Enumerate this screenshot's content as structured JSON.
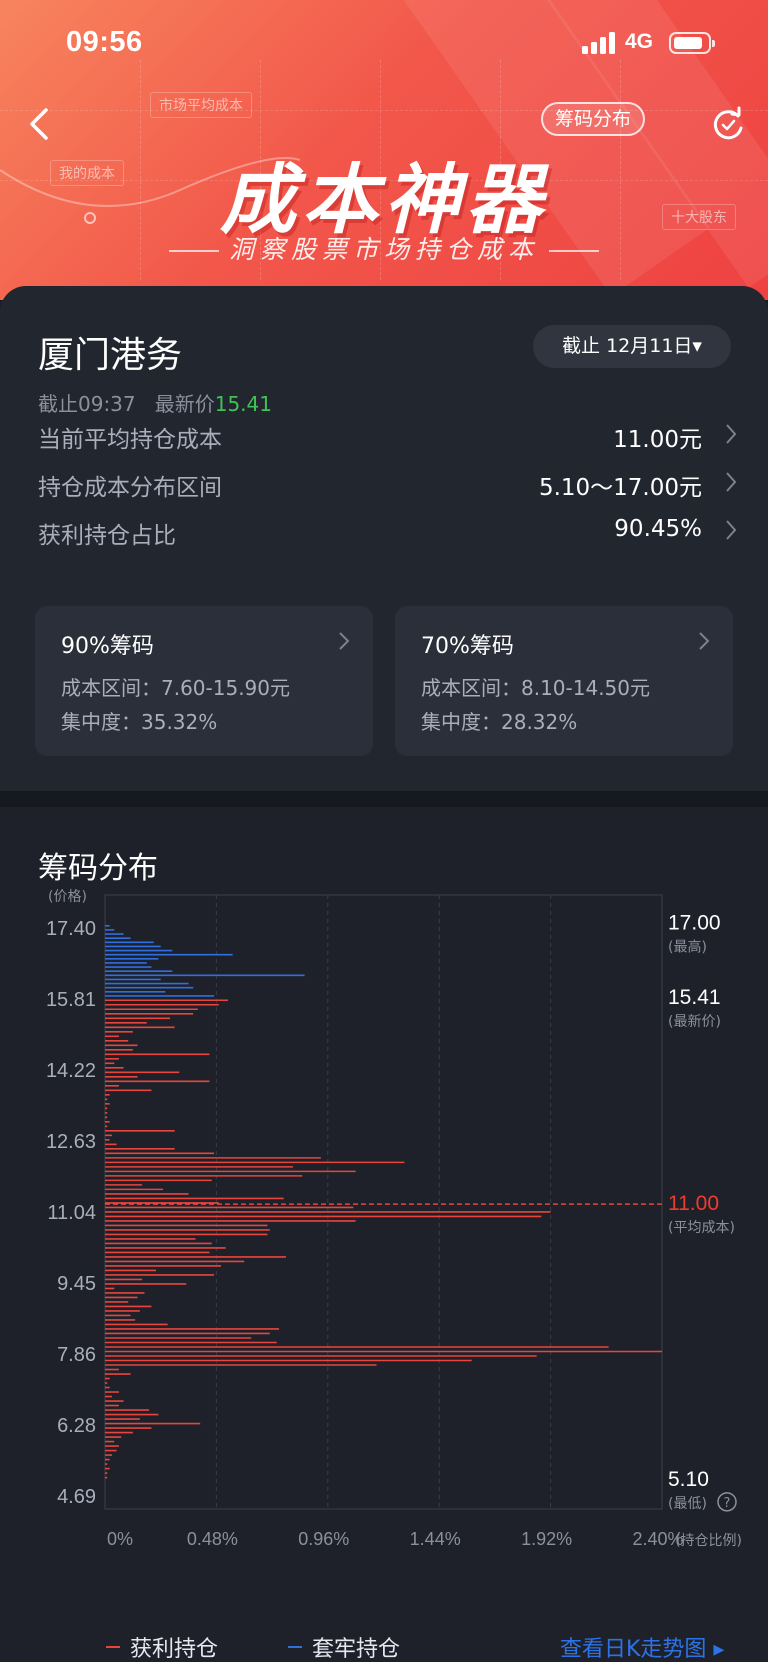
{
  "status_bar": {
    "time": "09:56",
    "network": "4G"
  },
  "header": {
    "title": "成本神器",
    "subtitle": "洞察股票市场持仓成本",
    "tag": "筹码分布",
    "decor_labels": [
      "市场平均成本",
      "我的成本",
      "十大股东"
    ]
  },
  "stock": {
    "name": "厦门港务",
    "date_selector": "截止 12月11日▾",
    "cutoff_label": "截止09:37",
    "latest_price_label": "最新价",
    "latest_price": "15.41"
  },
  "summary_rows": [
    {
      "label": "当前平均持仓成本",
      "value": "11.00元"
    },
    {
      "label": "持仓成本分布区间",
      "value": "5.10～17.00元"
    },
    {
      "label": "获利持仓占比",
      "value": "90.45%"
    }
  ],
  "concentration": [
    {
      "title": "90%筹码",
      "range": "成本区间：7.60-15.90元",
      "degree": "集中度：35.32%"
    },
    {
      "title": "70%筹码",
      "range": "成本区间：8.10-14.50元",
      "degree": "集中度：28.32%"
    }
  ],
  "chart_section": {
    "title": "筹码分布"
  },
  "chart_data": {
    "type": "bar",
    "orientation": "horizontal",
    "ylabel": "(价格)",
    "xlabel": "(持仓比例)",
    "yticks": [
      "17.40",
      "15.81",
      "14.22",
      "12.63",
      "11.04",
      "9.45",
      "7.86",
      "6.28",
      "4.69"
    ],
    "ylim": [
      4.69,
      17.4
    ],
    "xticks": [
      "0%",
      "0.48%",
      "0.96%",
      "1.44%",
      "1.92%",
      "2.40%"
    ],
    "xlim": [
      0,
      2.4
    ],
    "colors": {
      "profit": "#e8453c",
      "trapped": "#2f6fe0",
      "avg": "#e8453c"
    },
    "markers": [
      {
        "value": "17.00",
        "note": "(最高)"
      },
      {
        "value": "15.41",
        "note": "(最新价)"
      },
      {
        "value": "11.00",
        "note": "(平均成本)",
        "highlight": true
      },
      {
        "value": "5.10",
        "note": "(最低)"
      }
    ],
    "series": [
      {
        "name": "套牢持仓",
        "price_from": 15.41,
        "price_to": 17.0,
        "values": [
          0.02,
          0.04,
          0.08,
          0.11,
          0.21,
          0.24,
          0.29,
          0.55,
          0.23,
          0.18,
          0.2,
          0.29,
          0.86,
          0.24,
          0.36,
          0.38,
          0.26,
          0.47
        ]
      },
      {
        "name": "获利持仓",
        "price_from": 5.1,
        "price_to": 15.41,
        "values": [
          0.53,
          0.49,
          0.4,
          0.38,
          0.28,
          0.18,
          0.3,
          0.12,
          0.06,
          0.1,
          0.14,
          0.12,
          0.45,
          0.06,
          0.04,
          0.08,
          0.32,
          0.14,
          0.45,
          0.06,
          0.2,
          0.02,
          0.01,
          0.02,
          0.01,
          0.01,
          0.01,
          0.02,
          0.01,
          0.3,
          0.03,
          0.02,
          0.05,
          0.3,
          0.47,
          0.93,
          1.29,
          0.81,
          1.08,
          0.85,
          0.46,
          0.16,
          0.25,
          0.36,
          0.77,
          0.49,
          1.07,
          1.92,
          1.88,
          1.08,
          0.7,
          0.71,
          0.7,
          0.39,
          0.46,
          0.52,
          0.45,
          0.78,
          0.6,
          0.5,
          0.22,
          0.47,
          0.16,
          0.35,
          0.04,
          0.17,
          0.14,
          0.1,
          0.2,
          0.15,
          0.11,
          0.13,
          0.27,
          0.75,
          0.71,
          0.63,
          0.74,
          2.17,
          2.4,
          1.86,
          1.58,
          1.17,
          0.06,
          0.11,
          0.02,
          0.01,
          0.02,
          0.06,
          0.03,
          0.08,
          0.06,
          0.19,
          0.23,
          0.15,
          0.41,
          0.2,
          0.12,
          0.07,
          0.04,
          0.06,
          0.05,
          0.03,
          0.02,
          0.01,
          0.02,
          0.01,
          0.01
        ]
      }
    ],
    "average_cost": 11.0
  },
  "legend": {
    "profit": "获利持仓",
    "trapped": "套牢持仓"
  },
  "daily_k_link": "查看日K走势图 ▸"
}
